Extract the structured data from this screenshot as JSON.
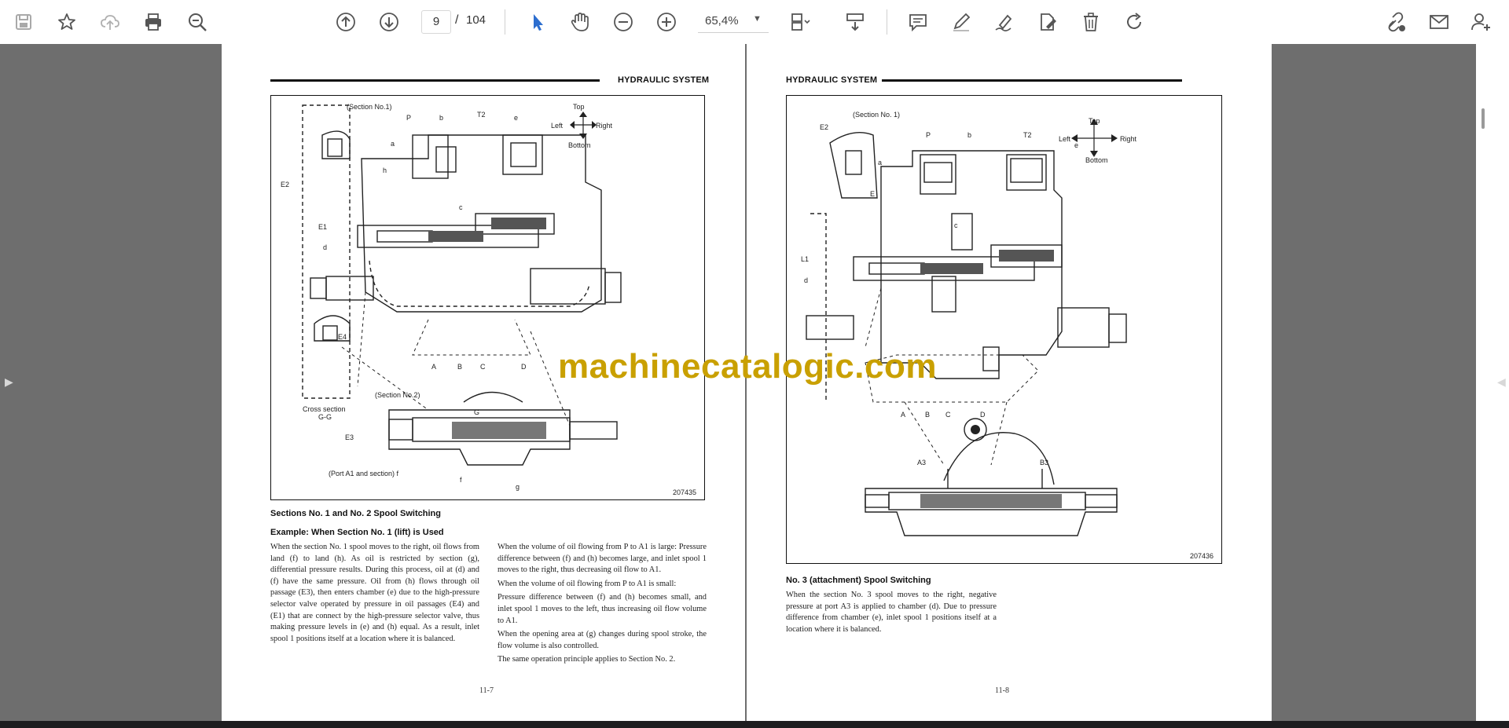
{
  "toolbar": {
    "page_current": "9",
    "page_separator": "/",
    "page_total": "104",
    "zoom": "65,4%",
    "icons": [
      "save-icon",
      "bookmark-star-icon",
      "cloud-upload-icon",
      "print-icon",
      "zoom-search-icon",
      "page-up-icon",
      "page-down-icon",
      "select-cursor-icon",
      "hand-pan-icon",
      "zoom-out-icon",
      "zoom-in-icon",
      "page-layout-icon",
      "scroll-mode-icon",
      "comment-icon",
      "highlight-pen-icon",
      "sign-pen-icon",
      "edit-fill-icon",
      "delete-icon",
      "rotate-icon",
      "share-link-icon",
      "email-icon",
      "add-user-icon"
    ],
    "accent_color": "#2d6ecf"
  },
  "left_page": {
    "header": "HYDRAULIC SYSTEM",
    "figure": {
      "number": "207435",
      "labels": {
        "section1": "(Section No.1)",
        "p": "P",
        "t2": "T2",
        "b": "b",
        "e": "e",
        "top": "Top",
        "left": "Left",
        "right": "Right",
        "bottom": "Bottom",
        "e2": "E2",
        "a": "a",
        "h": "h",
        "e1": "E1",
        "d": "d",
        "c": "c",
        "e4": "E4",
        "A": "A",
        "B": "B",
        "C": "C",
        "D": "D",
        "section2": "(Section No.2)",
        "cross_section": "Cross section",
        "gg": "G-G",
        "e3": "E3",
        "g_upper": "G",
        "f": "f",
        "g_lower": "g",
        "port_note": "(Port A1 and section) f"
      }
    },
    "section_title": "Sections No. 1 and No. 2 Spool Switching",
    "example_title": "Example: When Section No. 1 (lift) is Used",
    "col1": "When the section No. 1 spool moves to the right, oil flows from land (f) to land (h). As oil is restricted by section (g), differential pressure results. During this process, oil at (d) and (f) have the same pressure. Oil from (h) flows through oil passage (E3), then enters chamber (e) due to the high-pressure selector valve operated by pressure in oil passages (E4) and (E1) that are connect by the high-pressure selector valve, thus making pressure levels in (e) and (h) equal. As a result, inlet spool 1 positions itself at a location where it is balanced.",
    "col2_p1": "When the volume of oil flowing from P to A1 is large: Pressure difference between (f) and (h) becomes large, and inlet spool 1 moves to the right, thus decreasing oil flow to A1.",
    "col2_p2": "When the volume of oil flowing from P to A1 is small:",
    "col2_p3": "Pressure difference between (f) and (h) becomes small, and inlet spool 1 moves to the left, thus increasing oil flow volume to A1.",
    "col2_p4": "When the opening area at (g) changes during spool stroke, the flow volume is also controlled.",
    "col2_p5": "The same operation principle applies to Section No. 2.",
    "folio": "11-7"
  },
  "right_page": {
    "header": "HYDRAULIC SYSTEM",
    "figure": {
      "number": "207436",
      "labels": {
        "e2": "E2",
        "section1": "(Section No. 1)",
        "p": "P",
        "b": "b",
        "t2": "T2",
        "e": "e",
        "top": "Top",
        "left": "Left",
        "right": "Right",
        "bottom": "Bottom",
        "a": "a",
        "E": "E",
        "c": "c",
        "L1": "L1",
        "d": "d",
        "A": "A",
        "B": "B",
        "C": "C",
        "D": "D",
        "a3": "A3",
        "b3": "B3"
      }
    },
    "section_title": "No. 3 (attachment) Spool Switching",
    "body": "When the section No. 3 spool moves to the right, negative pressure at port A3 is applied to chamber (d). Due to pressure difference from chamber (e), inlet spool 1 positions itself at a location where it is balanced.",
    "folio": "11-8"
  },
  "watermark": "machinecatalogic.com"
}
